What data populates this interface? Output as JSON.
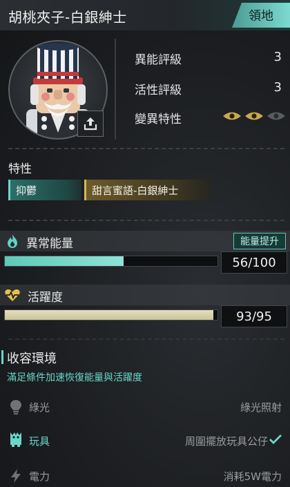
{
  "header": {
    "title": "胡桃夾子-白銀紳士",
    "territory_label": "領地"
  },
  "stats": [
    {
      "label": "異能評級",
      "value": "3"
    },
    {
      "label": "活性評級",
      "value": "3"
    },
    {
      "label": "變異特性",
      "value": ""
    }
  ],
  "mutation_eyes": {
    "lit": 2,
    "total": 3
  },
  "traits": {
    "title": "特性",
    "items": [
      "抑鬱",
      "甜言蜜語-白銀紳士"
    ]
  },
  "energy": {
    "label": "異常能量",
    "boost_label": "能量提升",
    "value": "56/100",
    "current": 56,
    "max": 100,
    "color": "#5fc9b9"
  },
  "activity": {
    "label": "活躍度",
    "value": "93/95",
    "current": 93,
    "max": 95,
    "color": "#c9c39a"
  },
  "containment": {
    "title": "收容環境",
    "subtitle": "滿足條件加速恢復能量與活躍度",
    "conditions": [
      {
        "label": "綠光",
        "value": "綠光照射",
        "met": false
      },
      {
        "label": "玩具",
        "value": "周圍擺放玩具公仔",
        "met": true
      },
      {
        "label": "電力",
        "value": "消耗5W電力",
        "met": false
      }
    ]
  },
  "colors": {
    "accent": "#6ad6c9",
    "gold": "#d8b856"
  }
}
